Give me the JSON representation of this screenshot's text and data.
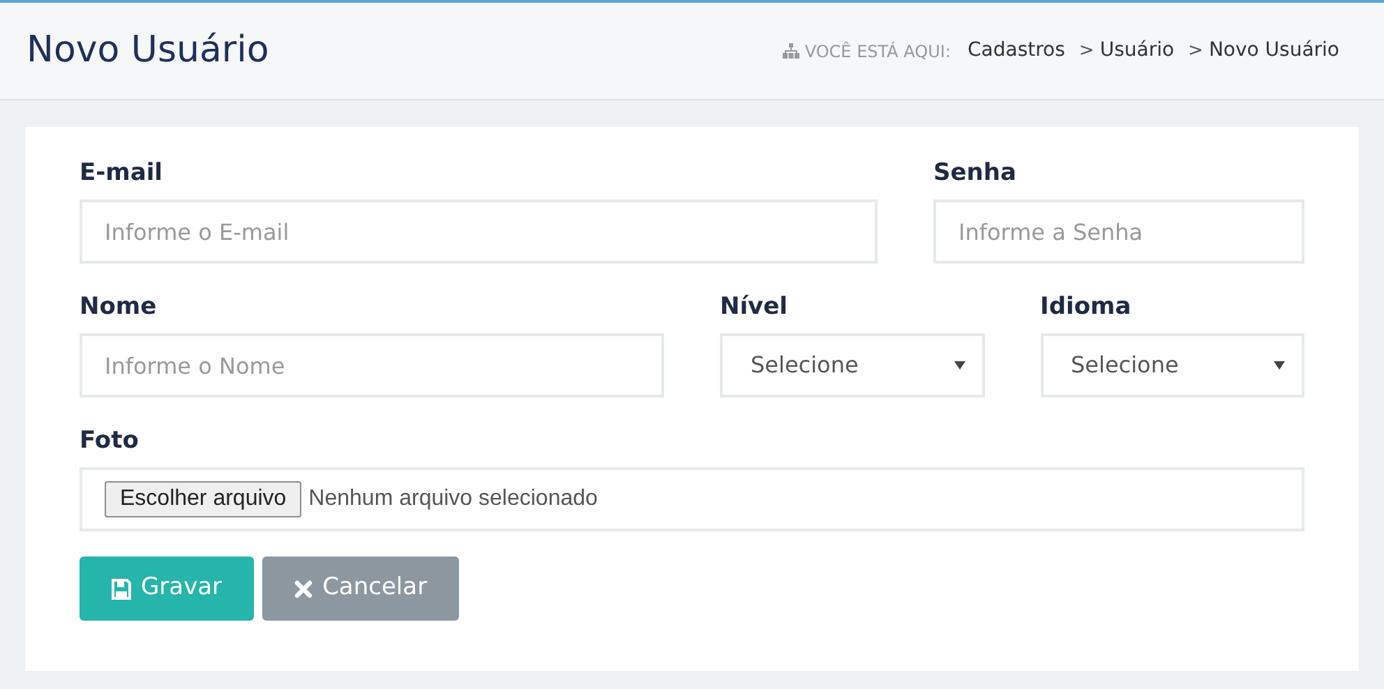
{
  "header": {
    "title": "Novo Usuário",
    "breadcrumb": {
      "label": "VOCÊ ESTÁ AQUI:",
      "items": [
        {
          "text": "Cadastros"
        },
        {
          "text": "Usuário",
          "separator": ">"
        },
        {
          "text": "Novo Usuário",
          "separator": ">"
        }
      ]
    }
  },
  "form": {
    "rows": [
      {
        "fields": [
          {
            "kind": "text",
            "label": "E-mail",
            "placeholder": "Informe o E-mail"
          },
          {
            "kind": "text",
            "label": "Senha",
            "placeholder": "Informe a Senha"
          }
        ]
      },
      {
        "fields": [
          {
            "kind": "text",
            "label": "Nome",
            "placeholder": "Informe o Nome"
          },
          {
            "kind": "select",
            "label": "Nível",
            "value": "Selecione"
          },
          {
            "kind": "select",
            "label": "Idioma",
            "value": "Selecione"
          }
        ]
      },
      {
        "fields": [
          {
            "kind": "file",
            "label": "Foto",
            "button": "Escolher arquivo",
            "status": "Nenhum arquivo selecionado"
          }
        ]
      }
    ],
    "buttons": [
      {
        "kind": "save",
        "label": "Gravar"
      },
      {
        "kind": "cancel",
        "label": "Cancelar"
      }
    ]
  }
}
